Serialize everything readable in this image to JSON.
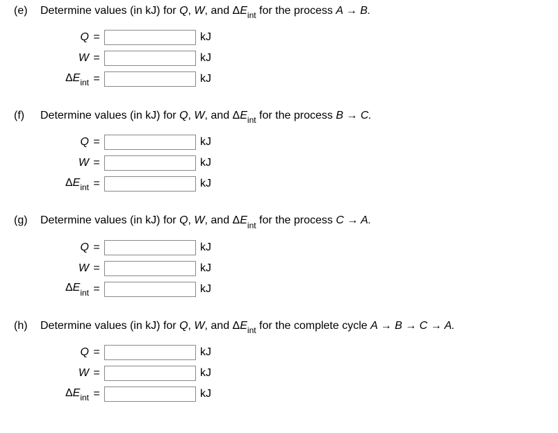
{
  "questions": [
    {
      "label": "(e)",
      "text_prefix": "Determine values (in kJ) for ",
      "text_suffix": " for the process ",
      "process": "A → B.",
      "rows": [
        {
          "var_type": "Q",
          "unit": "kJ"
        },
        {
          "var_type": "W",
          "unit": "kJ"
        },
        {
          "var_type": "DEint",
          "unit": "kJ"
        }
      ]
    },
    {
      "label": "(f)",
      "text_prefix": "Determine values (in kJ) for ",
      "text_suffix": " for the process ",
      "process": "B → C.",
      "rows": [
        {
          "var_type": "Q",
          "unit": "kJ"
        },
        {
          "var_type": "W",
          "unit": "kJ"
        },
        {
          "var_type": "DEint",
          "unit": "kJ"
        }
      ]
    },
    {
      "label": "(g)",
      "text_prefix": "Determine values (in kJ) for ",
      "text_suffix": " for the process ",
      "process": "C → A.",
      "rows": [
        {
          "var_type": "Q",
          "unit": "kJ"
        },
        {
          "var_type": "W",
          "unit": "kJ"
        },
        {
          "var_type": "DEint",
          "unit": "kJ"
        }
      ]
    },
    {
      "label": "(h)",
      "text_prefix": "Determine values (in kJ) for ",
      "text_suffix": " for the complete cycle ",
      "process": "A → B → C → A.",
      "rows": [
        {
          "var_type": "Q",
          "unit": "kJ"
        },
        {
          "var_type": "W",
          "unit": "kJ"
        },
        {
          "var_type": "DEint",
          "unit": "kJ"
        }
      ]
    }
  ],
  "common": {
    "vars_list": "Q, W, and ",
    "q_label": "Q",
    "w_label": "W",
    "equals": "=",
    "delta": "Δ",
    "e_char": "E",
    "int_sub": "int",
    "and_word": ", and "
  }
}
